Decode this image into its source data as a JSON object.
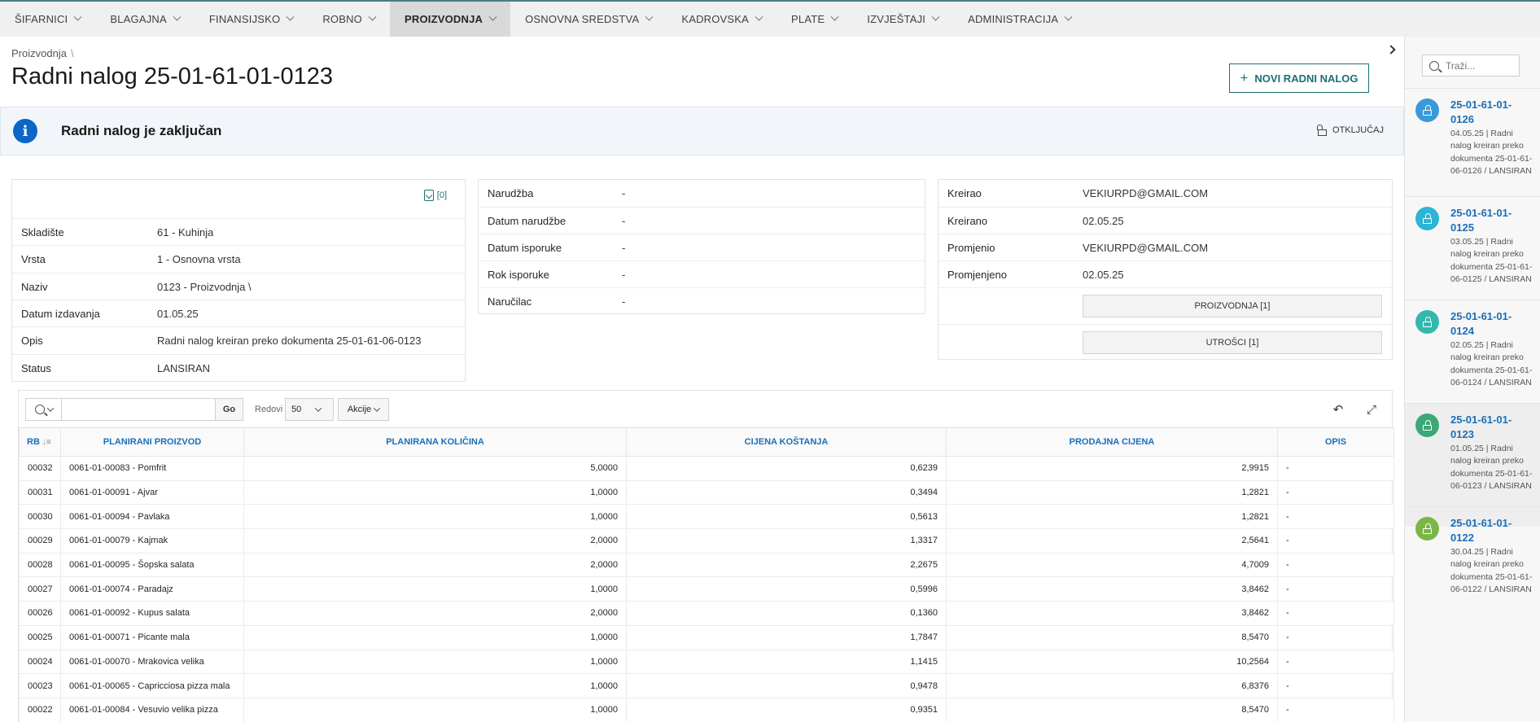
{
  "nav": [
    {
      "label": "ŠIFARNICI"
    },
    {
      "label": "BLAGAJNA"
    },
    {
      "label": "FINANSIJSKO"
    },
    {
      "label": "ROBNO"
    },
    {
      "label": "PROIZVODNJA"
    },
    {
      "label": "OSNOVNA SREDSTVA"
    },
    {
      "label": "KADROVSKA"
    },
    {
      "label": "PLATE"
    },
    {
      "label": "IZVJEŠTAJI"
    },
    {
      "label": "ADMINISTRACIJA"
    }
  ],
  "header": {
    "breadcrumb": "Proizvodnja",
    "breadcrumb_sep": "\\",
    "title": "Radni nalog 25-01-61-01-0123",
    "new_button": "NOVI RADNI NALOG",
    "new_button_icon": "+"
  },
  "alert": {
    "icon": "i",
    "text": "Radni nalog je zaključan",
    "unlock_label": "OTKLJUČAJ"
  },
  "card1": {
    "docs_link": "[0]",
    "rows": [
      {
        "label": "Skladište",
        "value": "61 - Kuhinja"
      },
      {
        "label": "Vrsta",
        "value": "1 - Osnovna vrsta"
      },
      {
        "label": "Naziv",
        "value": "0123 - Proizvodnja \\"
      },
      {
        "label": "Datum izdavanja",
        "value": "01.05.25"
      },
      {
        "label": "Opis",
        "value": "Radni nalog kreiran preko dokumenta 25-01-61-06-0123"
      },
      {
        "label": "Status",
        "value": "LANSIRAN"
      }
    ]
  },
  "card2": {
    "rows": [
      {
        "label": "Narudžba",
        "value": "-"
      },
      {
        "label": "Datum narudžbe",
        "value": "-"
      },
      {
        "label": "Datum isporuke",
        "value": "-"
      },
      {
        "label": "Rok isporuke",
        "value": "-"
      },
      {
        "label": "Naručilac",
        "value": "-"
      }
    ]
  },
  "card3": {
    "rows": [
      {
        "label": "Kreirao",
        "value": "VEKIURPD@GMAIL.COM"
      },
      {
        "label": "Kreirano",
        "value": "02.05.25"
      },
      {
        "label": "Promjenio",
        "value": "VEKIURPD@GMAIL.COM"
      },
      {
        "label": "Promjenjeno",
        "value": "02.05.25"
      }
    ],
    "btn_proizvodnja": "PROIZVODNJA [1]",
    "btn_utrosci": "UTROŠCI [1]"
  },
  "report": {
    "go_label": "Go",
    "rows_label": "Redovi",
    "rows_value": "50",
    "actions_label": "Akcije",
    "columns": [
      "RB",
      "PLANIRANI PROIZVOD",
      "PLANIRANA KOLIČINA",
      "CIJENA KOŠTANJA",
      "PRODAJNA CIJENA",
      "OPIS"
    ],
    "rows": [
      {
        "rb": "00032",
        "product": "0061-01-00083 - Pomfrit",
        "qty": "5,0000",
        "cost": "0,6239",
        "price": "2,9915",
        "desc": "-"
      },
      {
        "rb": "00031",
        "product": "0061-01-00091 - Ajvar",
        "qty": "1,0000",
        "cost": "0,3494",
        "price": "1,2821",
        "desc": "-"
      },
      {
        "rb": "00030",
        "product": "0061-01-00094 - Pavlaka",
        "qty": "1,0000",
        "cost": "0,5613",
        "price": "1,2821",
        "desc": "-"
      },
      {
        "rb": "00029",
        "product": "0061-01-00079 - Kajmak",
        "qty": "2,0000",
        "cost": "1,3317",
        "price": "2,5641",
        "desc": "-"
      },
      {
        "rb": "00028",
        "product": "0061-01-00095 - Šopska salata",
        "qty": "2,0000",
        "cost": "2,2675",
        "price": "4,7009",
        "desc": "-"
      },
      {
        "rb": "00027",
        "product": "0061-01-00074 - Paradajz",
        "qty": "1,0000",
        "cost": "0,5996",
        "price": "3,8462",
        "desc": "-"
      },
      {
        "rb": "00026",
        "product": "0061-01-00092 - Kupus salata",
        "qty": "2,0000",
        "cost": "0,1360",
        "price": "3,8462",
        "desc": "-"
      },
      {
        "rb": "00025",
        "product": "0061-01-00071 - Picante mala",
        "qty": "1,0000",
        "cost": "1,7847",
        "price": "8,5470",
        "desc": "-"
      },
      {
        "rb": "00024",
        "product": "0061-01-00070 - Mrakovica velika",
        "qty": "1,0000",
        "cost": "1,1415",
        "price": "10,2564",
        "desc": "-"
      },
      {
        "rb": "00023",
        "product": "0061-01-00065 - Capricciosa pizza mala",
        "qty": "1,0000",
        "cost": "0,9478",
        "price": "6,8376",
        "desc": "-"
      },
      {
        "rb": "00022",
        "product": "0061-01-00084 - Vesuvio velika pizza",
        "qty": "1,0000",
        "cost": "0,9351",
        "price": "8,5470",
        "desc": "-"
      }
    ]
  },
  "sidebar": {
    "search_placeholder": "Traži...",
    "items": [
      {
        "title": "25-01-61-01-0126",
        "desc": "04.05.25 | Radni nalog kreiran preko dokumenta 25-01-61-06-0126 / LANSIRAN",
        "color": "#3a9ad9"
      },
      {
        "title": "25-01-61-01-0125",
        "desc": "03.05.25 | Radni nalog kreiran preko dokumenta 25-01-61-06-0125 / LANSIRAN",
        "color": "#2bb5d6"
      },
      {
        "title": "25-01-61-01-0124",
        "desc": "02.05.25 | Radni nalog kreiran preko dokumenta 25-01-61-06-0124 / LANSIRAN",
        "color": "#33b8ae"
      },
      {
        "title": "25-01-61-01-0123",
        "desc": "01.05.25 | Radni nalog kreiran preko dokumenta 25-01-61-06-0123 / LANSIRAN",
        "color": "#3aa877"
      },
      {
        "title": "25-01-61-01-0122",
        "desc": "30.04.25 | Radni nalog kreiran preko dokumenta 25-01-61-06-0122 / LANSIRAN",
        "color": "#7ab648"
      }
    ]
  },
  "colors": {
    "accent": "#1d6f73",
    "link": "#1a6fb8",
    "info": "#0b67c6"
  }
}
